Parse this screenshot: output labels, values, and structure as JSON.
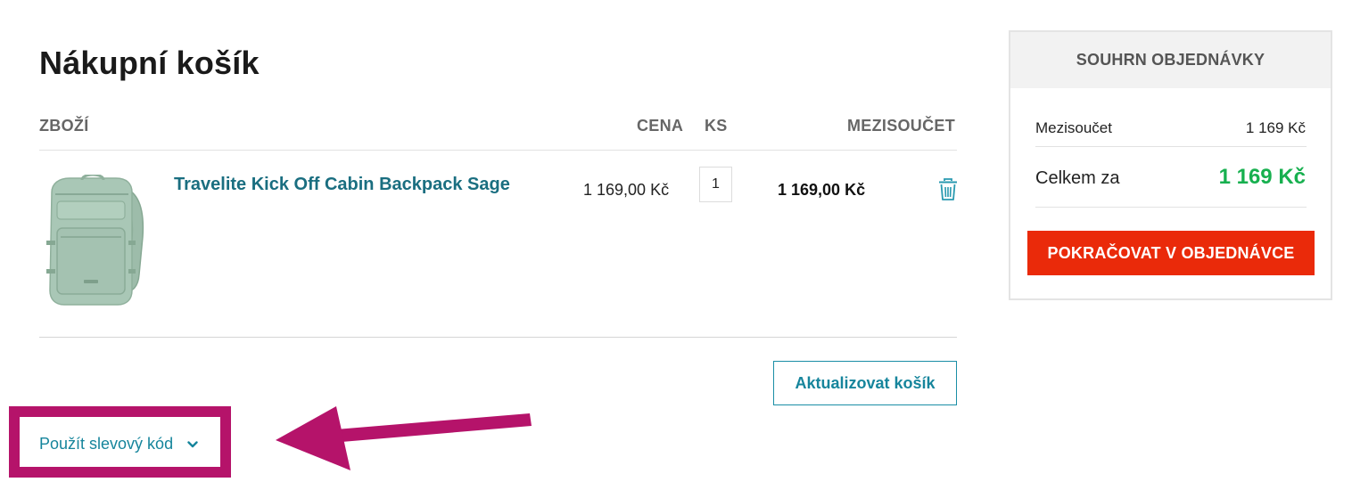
{
  "cart": {
    "title": "Nákupní košík",
    "columns": {
      "product": "ZBOŽÍ",
      "price": "CENA",
      "qty": "KS",
      "subtotal": "MEZISOUČET"
    },
    "items": [
      {
        "name": "Travelite Kick Off Cabin Backpack Sage",
        "price": "1 169,00 Kč",
        "qty": "1",
        "subtotal": "1 169,00 Kč",
        "image_icon": "backpack-image"
      }
    ],
    "update_label": "Aktualizovat košík",
    "discount_label": "Použít slevový kód"
  },
  "summary": {
    "title": "SOUHRN OBJEDNÁVKY",
    "subtotal_label": "Mezisoučet",
    "subtotal_value": "1 169 Kč",
    "total_label": "Celkem za",
    "total_value": "1 169 Kč",
    "checkout_label": "POKRAČOVAT V OBJEDNÁVCE"
  },
  "colors": {
    "accent_teal": "#16859c",
    "checkout_red": "#ea2a0a",
    "total_green": "#17b04f",
    "highlight_magenta": "#b5136a"
  },
  "icons": {
    "delete": "trash-icon",
    "expand": "chevron-down-icon",
    "pointer": "arrow-annotation-icon"
  }
}
